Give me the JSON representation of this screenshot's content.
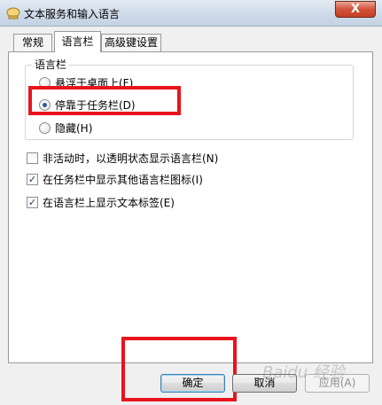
{
  "window": {
    "title": "文本服务和输入语言",
    "close_glyph": "X"
  },
  "tabs": [
    {
      "label": "常规",
      "active": false
    },
    {
      "label": "语言栏",
      "active": true
    },
    {
      "label": "高级键设置",
      "active": false
    }
  ],
  "language_bar_group": {
    "title": "语言栏",
    "options": [
      {
        "label": "悬浮于桌面上(F)",
        "checked": false
      },
      {
        "label": "停靠于任务栏(D)",
        "checked": true
      },
      {
        "label": "隐藏(H)",
        "checked": false
      }
    ]
  },
  "checkboxes": [
    {
      "label": "非活动时，以透明状态显示语言栏(N)",
      "checked": false
    },
    {
      "label": "在任务栏中显示其他语言栏图标(I)",
      "checked": true
    },
    {
      "label": "在语言栏上显示文本标签(E)",
      "checked": true
    }
  ],
  "buttons": {
    "ok": "确定",
    "cancel": "取消",
    "apply": "应用(A)"
  },
  "annotation_color": "#e8141d",
  "watermark": "Baidu 经验"
}
